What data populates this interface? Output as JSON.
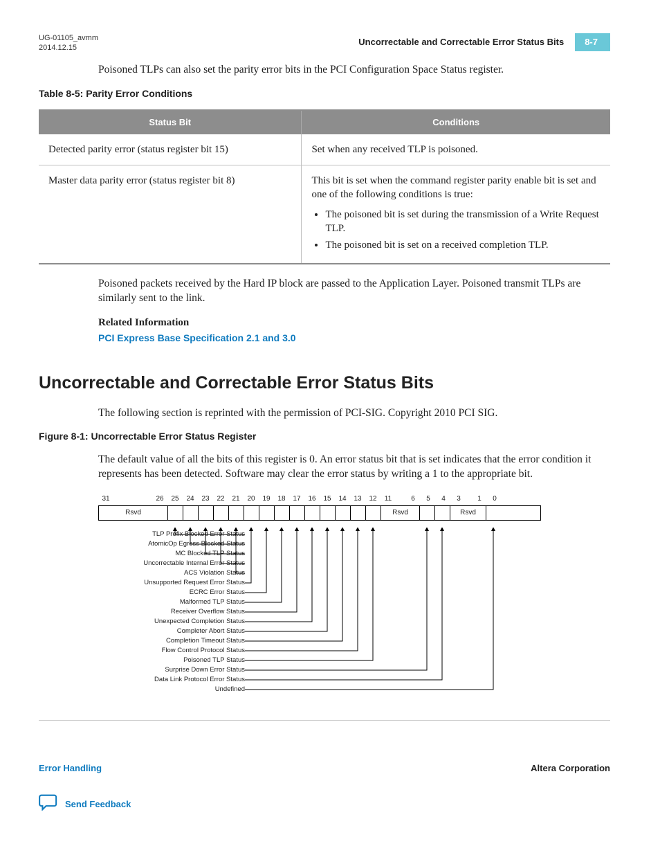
{
  "header": {
    "doc_id": "UG-01105_avmm",
    "date": "2014.12.15",
    "running_title": "Uncorrectable and Correctable Error Status Bits",
    "page_num": "8-7"
  },
  "intro_para": "Poisoned TLPs can also set the parity error bits in the PCI Configuration Space Status register.",
  "table85": {
    "caption": "Table 8-5: Parity Error Conditions",
    "col1": "Status Bit",
    "col2": "Conditions",
    "rows": [
      {
        "status": "Detected parity error (status register bit 15)",
        "cond": "Set when any received TLP is poisoned."
      },
      {
        "status": "Master data parity error (status register bit 8)",
        "cond_intro": "This bit is set when the command register parity enable bit is set and one of the following conditions is true:",
        "bullets": [
          "The poisoned bit is set during the transmission of a Write Request TLP.",
          "The poisoned bit is set on a received completion TLP."
        ]
      }
    ]
  },
  "para_after_table": "Poisoned packets received by the Hard IP block are passed to the Application Layer. Poisoned transmit TLPs are similarly sent to the link.",
  "related": {
    "heading": "Related Information",
    "link_text": "PCI Express Base Specification 2.1 and 3.0"
  },
  "section_h1": "Uncorrectable and Correctable Error Status Bits",
  "section_intro": "The following section is reprinted with the permission of PCI-SIG. Copyright 2010 PCI SIG.",
  "fig81": {
    "caption": "Figure 8-1: Uncorrectable Error Status Register",
    "desc": "The default value of all the bits of this register is 0. An error status bit that is set indicates that the error condition it represents has been detected. Software may clear the error status by writing a 1 to the appropriate bit."
  },
  "register": {
    "bit_numbers": [
      "31",
      "26",
      "25",
      "24",
      "23",
      "22",
      "21",
      "20",
      "19",
      "18",
      "17",
      "16",
      "15",
      "14",
      "13",
      "12",
      "11",
      "6",
      "5",
      "4",
      "3",
      "1",
      "0"
    ],
    "rsvd": "Rsvd",
    "labels": [
      "TLP Prefix Blocked Error Status",
      "AtomicOp Egress Blocked Status",
      "MC Blocked TLP Status",
      "Uncorrectable Internal Error Status",
      "ACS Violation Status",
      "Unsupported Request Error Status",
      "ECRC Error Status",
      "Malformed TLP Status",
      "Receiver Overflow Status",
      "Unexpected Completion Status",
      "Completer Abort Status",
      "Completion Timeout Status",
      "Flow Control Protocol Status",
      "Poisoned TLP Status",
      "Surprise Down Error Status",
      "Data Link Protocol Error Status",
      "Undefined"
    ]
  },
  "footer": {
    "left_link": "Error Handling",
    "right": "Altera Corporation",
    "feedback": "Send Feedback"
  }
}
